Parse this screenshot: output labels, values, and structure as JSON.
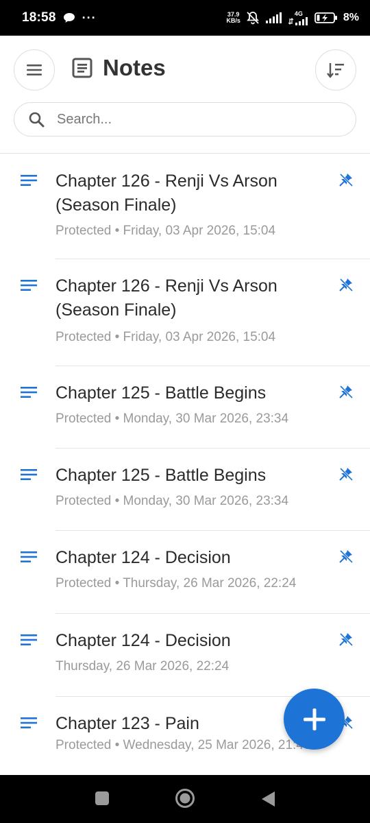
{
  "status_bar": {
    "time": "18:58",
    "net_speed_value": "37.9",
    "net_speed_unit": "KB/s",
    "network_type": "4G",
    "battery_percent": "8%"
  },
  "header": {
    "title": "Notes",
    "menu_icon": "hamburger-menu-icon",
    "sort_icon": "sort-icon",
    "notes_icon": "notes-document-icon"
  },
  "search": {
    "placeholder": "Search..."
  },
  "notes": [
    {
      "title": "Chapter 126 - Renji Vs Arson (Season Finale)",
      "meta": "Protected • Friday, 03 Apr 2026, 15:04"
    },
    {
      "title": "Chapter 126 - Renji Vs Arson (Season Finale)",
      "meta": "Protected • Friday, 03 Apr 2026, 15:04"
    },
    {
      "title": "Chapter 125 - Battle Begins",
      "meta": "Protected • Monday, 30 Mar 2026, 23:34"
    },
    {
      "title": "Chapter 125 - Battle Begins",
      "meta": "Protected • Monday, 30 Mar 2026, 23:34"
    },
    {
      "title": "Chapter 124 - Decision",
      "meta": "Protected • Thursday, 26 Mar 2026, 22:24"
    },
    {
      "title": "Chapter 124 - Decision",
      "meta": "Thursday, 26 Mar 2026, 22:24"
    },
    {
      "title": "Chapter 123 - Pain",
      "meta": "Protected • Wednesday, 25 Mar 2026, 21:40"
    }
  ],
  "colors": {
    "accent": "#1e73d6",
    "title_text": "#2b2b2b",
    "meta_text": "#9a9a9a"
  },
  "fab": {
    "icon": "plus-icon"
  },
  "nav": {
    "square": "recent-apps-icon",
    "circle": "home-icon",
    "triangle": "back-icon"
  }
}
